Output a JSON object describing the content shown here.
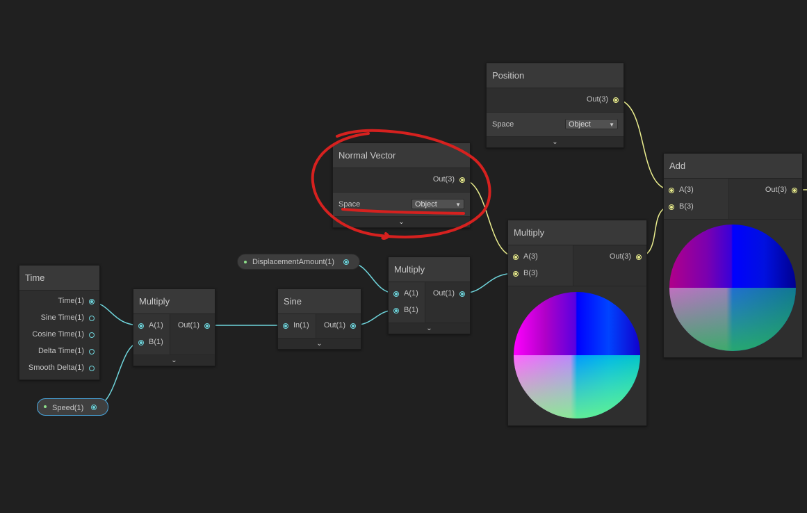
{
  "nodes": {
    "time": {
      "title": "Time",
      "outputs": [
        "Time(1)",
        "Sine Time(1)",
        "Cosine Time(1)",
        "Delta Time(1)",
        "Smooth Delta(1)"
      ]
    },
    "multiply1": {
      "title": "Multiply",
      "inputs": [
        "A(1)",
        "B(1)"
      ],
      "output": "Out(1)"
    },
    "sine": {
      "title": "Sine",
      "input": "In(1)",
      "output": "Out(1)"
    },
    "multiply2": {
      "title": "Multiply",
      "inputs": [
        "A(1)",
        "B(1)"
      ],
      "output": "Out(1)"
    },
    "multiply3": {
      "title": "Multiply",
      "inputs": [
        "A(3)",
        "B(3)"
      ],
      "output": "Out(3)"
    },
    "normal_vector": {
      "title": "Normal Vector",
      "output": "Out(3)",
      "space_label": "Space",
      "space_value": "Object"
    },
    "position": {
      "title": "Position",
      "output": "Out(3)",
      "space_label": "Space",
      "space_value": "Object"
    },
    "add": {
      "title": "Add",
      "inputs": [
        "A(3)",
        "B(3)"
      ],
      "output": "Out(3)"
    }
  },
  "properties": {
    "displacement": "DisplacementAmount(1)",
    "speed": "Speed(1)"
  },
  "icons": {
    "expand": "chevron-down-icon",
    "dropdown": "caret-down-icon"
  },
  "colors": {
    "background": "#202020",
    "float_wire": "#6fd5dc",
    "vector3_wire": "#ebee8e",
    "annotation": "#d6211f",
    "selection": "#4aa8e0"
  }
}
